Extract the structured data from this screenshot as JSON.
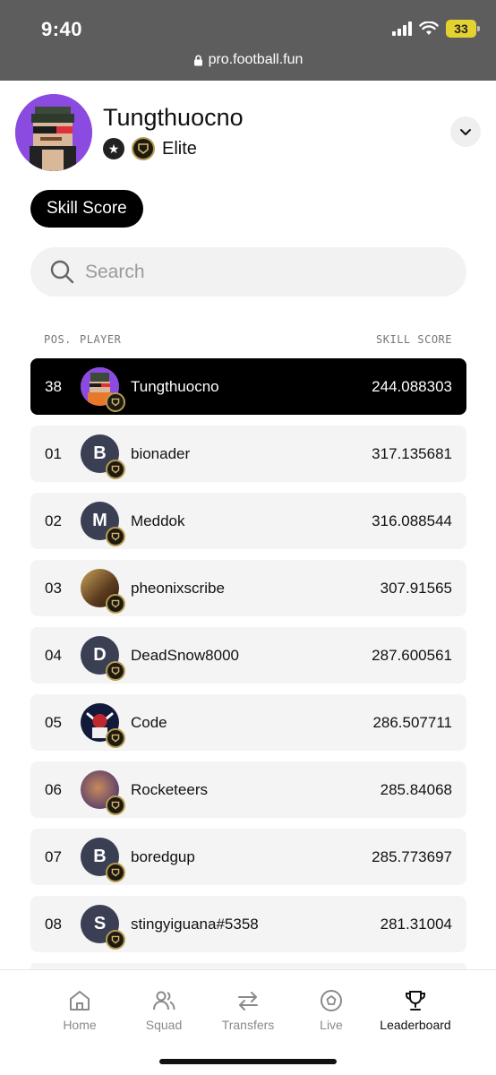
{
  "status_bar": {
    "time": "9:40",
    "battery": "33",
    "url": "pro.football.fun"
  },
  "profile": {
    "username": "Tungthuocno",
    "tier": "Elite"
  },
  "tabs": {
    "active": "Skill Score"
  },
  "search": {
    "placeholder": "Search"
  },
  "columns": {
    "position": "POS.",
    "player": "PLAYER",
    "score": "SKILL SCORE"
  },
  "current_user_row": {
    "pos": "38",
    "name": "Tungthuocno",
    "score": "244.088303"
  },
  "rows": [
    {
      "pos": "01",
      "name": "bionader",
      "initial": "B",
      "score": "317.135681"
    },
    {
      "pos": "02",
      "name": "Meddok",
      "initial": "M",
      "score": "316.088544"
    },
    {
      "pos": "03",
      "name": "pheonixscribe",
      "initial": "",
      "score": "307.91565"
    },
    {
      "pos": "04",
      "name": "DeadSnow8000",
      "initial": "D",
      "score": "287.600561"
    },
    {
      "pos": "05",
      "name": "Code",
      "initial": "",
      "score": "286.507711"
    },
    {
      "pos": "06",
      "name": "Rocketeers",
      "initial": "",
      "score": "285.84068"
    },
    {
      "pos": "07",
      "name": "boredgup",
      "initial": "B",
      "score": "285.773697"
    },
    {
      "pos": "08",
      "name": "stingyiguana#5358",
      "initial": "S",
      "score": "281.31004"
    }
  ],
  "nav": {
    "home": "Home",
    "squad": "Squad",
    "transfers": "Transfers",
    "live": "Live",
    "leaderboard": "Leaderboard"
  },
  "colors": {
    "accent": "#000000",
    "avatar_default": "#3a3f53",
    "badge_gold": "#b89a52",
    "profile_purple": "#8c4be0"
  }
}
